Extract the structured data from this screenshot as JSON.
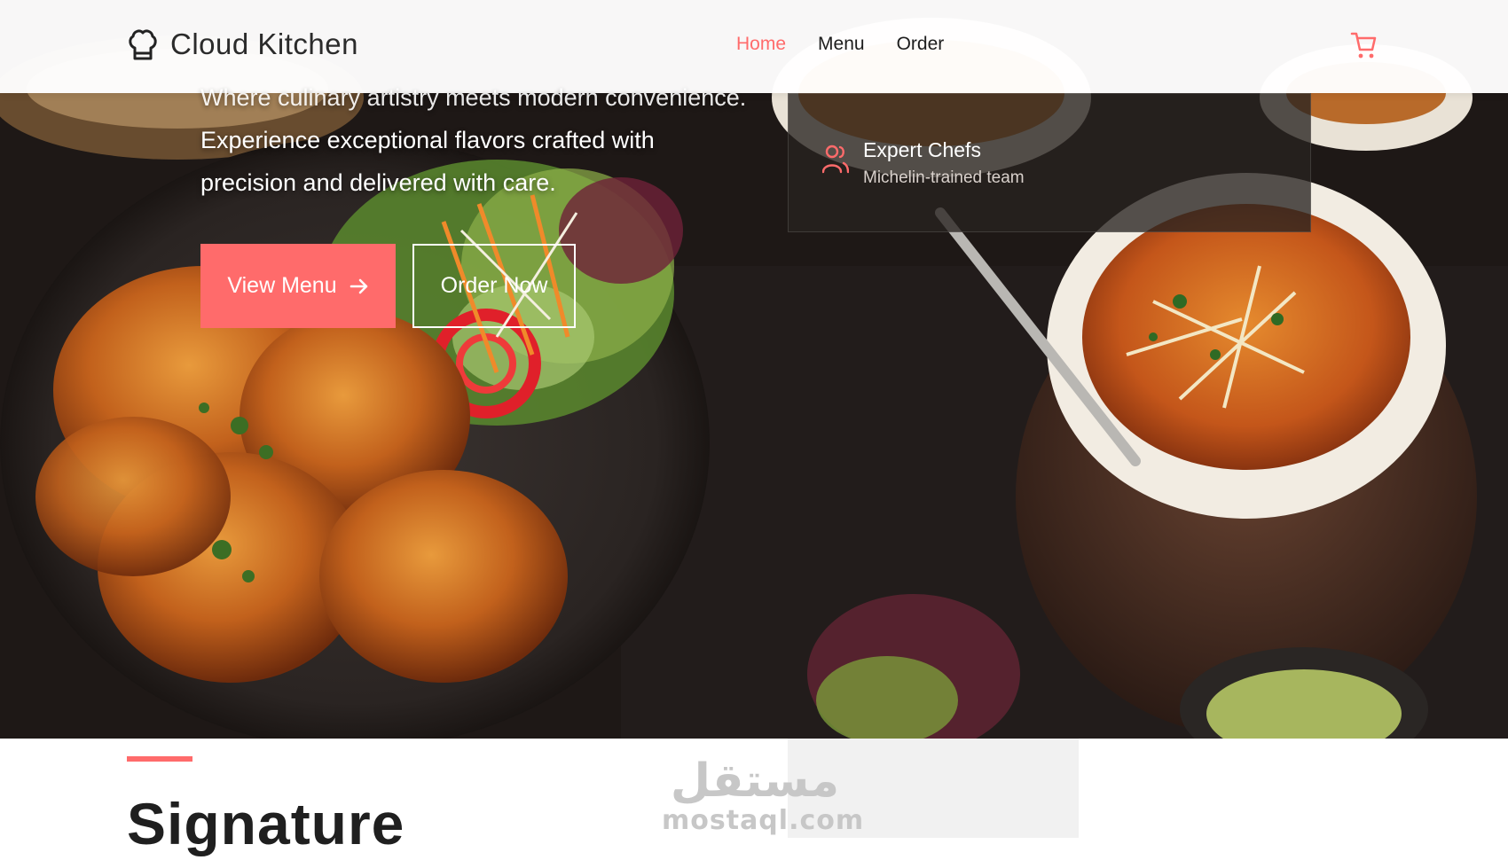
{
  "header": {
    "brand_name": "Cloud Kitchen",
    "nav": {
      "home": "Home",
      "menu": "Menu",
      "order": "Order"
    },
    "accent_color": "#ff6b6b"
  },
  "hero": {
    "tagline_cut": "Where culinary artistry meets modern convenience.",
    "description": "Experience exceptional flavors crafted with precision and delivered with care.",
    "primary_button": "View Menu",
    "secondary_button": "Order Now"
  },
  "feature_card": {
    "title": "Expert Chefs",
    "subtitle": "Michelin-trained team"
  },
  "section": {
    "title": "Signature"
  },
  "watermark": {
    "arabic": "مستقل",
    "latin": "mostaql.com"
  }
}
